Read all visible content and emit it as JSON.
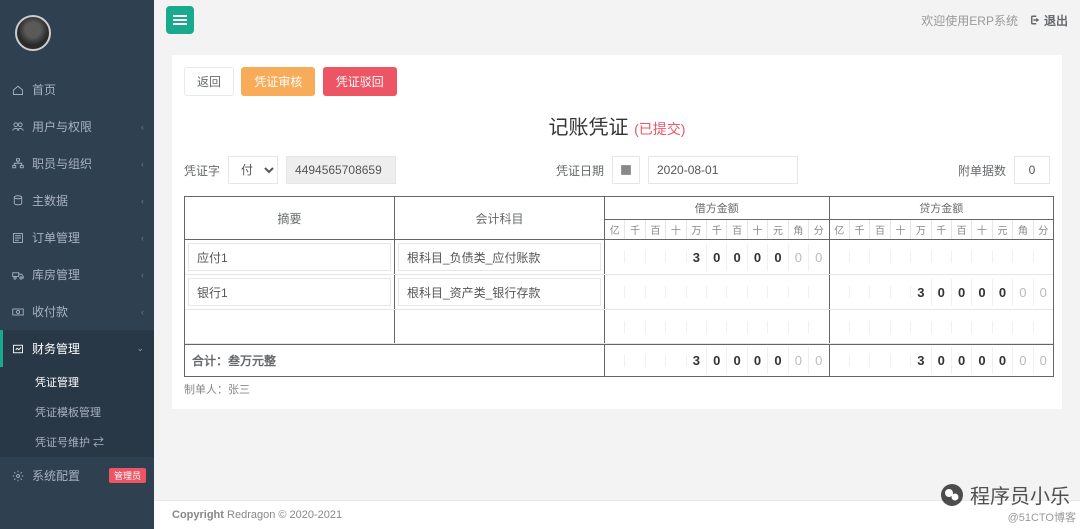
{
  "topbar": {
    "welcome": "欢迎使用ERP系统",
    "logout": "退出"
  },
  "sidebar": [
    {
      "icon": "home",
      "label": "首页"
    },
    {
      "icon": "users",
      "label": "用户与权限",
      "caret": true
    },
    {
      "icon": "sitemap",
      "label": "职员与组织",
      "caret": true
    },
    {
      "icon": "db",
      "label": "主数据",
      "caret": true
    },
    {
      "icon": "order",
      "label": "订单管理",
      "caret": true
    },
    {
      "icon": "truck",
      "label": "库房管理",
      "caret": true
    },
    {
      "icon": "money",
      "label": "收付款",
      "caret": true
    },
    {
      "icon": "finance",
      "label": "财务管理",
      "caret": true,
      "active": true,
      "children": [
        {
          "label": "凭证管理",
          "active": true
        },
        {
          "label": "凭证模板管理"
        },
        {
          "label": "凭证号维护 ⇄"
        }
      ]
    },
    {
      "icon": "gear",
      "label": "系统配置",
      "badge": "管理员"
    }
  ],
  "buttons": {
    "back": "返回",
    "audit": "凭证审核",
    "reject": "凭证驳回"
  },
  "title": "记账凭证",
  "status": "(已提交)",
  "formLabels": {
    "word": "凭证字",
    "wordVal": "付",
    "numberVal": "4494565708659",
    "date": "凭证日期",
    "dateVal": "2020-08-01",
    "attach": "附单据数",
    "attachVal": "0"
  },
  "tableHead": {
    "summary": "摘要",
    "subject": "会计科目",
    "debit": "借方金额",
    "credit": "贷方金额"
  },
  "units": [
    "亿",
    "千",
    "百",
    "十",
    "万",
    "千",
    "百",
    "十",
    "元",
    "角",
    "分"
  ],
  "rows": [
    {
      "summary": "应付1",
      "subject": "根科目_负债类_应付账款",
      "debit": [
        "",
        "",
        "",
        "",
        "3",
        "0",
        "0",
        "0",
        "0",
        "0",
        "0"
      ],
      "credit": [
        "",
        "",
        "",
        "",
        "",
        "",
        "",
        "",
        "",
        "",
        ""
      ]
    },
    {
      "summary": "银行1",
      "subject": "根科目_资产类_银行存款",
      "debit": [
        "",
        "",
        "",
        "",
        "",
        "",
        "",
        "",
        "",
        "",
        ""
      ],
      "credit": [
        "",
        "",
        "",
        "",
        "3",
        "0",
        "0",
        "0",
        "0",
        "0",
        "0"
      ]
    }
  ],
  "total": {
    "label": "合计：",
    "words": "叁万元整",
    "debit": [
      "",
      "",
      "",
      "",
      "3",
      "0",
      "0",
      "0",
      "0",
      "0",
      "0"
    ],
    "credit": [
      "",
      "",
      "",
      "",
      "3",
      "0",
      "0",
      "0",
      "0",
      "0",
      "0"
    ]
  },
  "maker": {
    "label": "制单人：",
    "name": "张三"
  },
  "footer": {
    "strong": "Copyright",
    "rest": " Redragon © 2020-2021"
  },
  "watermark": {
    "name": "程序员小乐",
    "sub": "@51CTO博客"
  }
}
